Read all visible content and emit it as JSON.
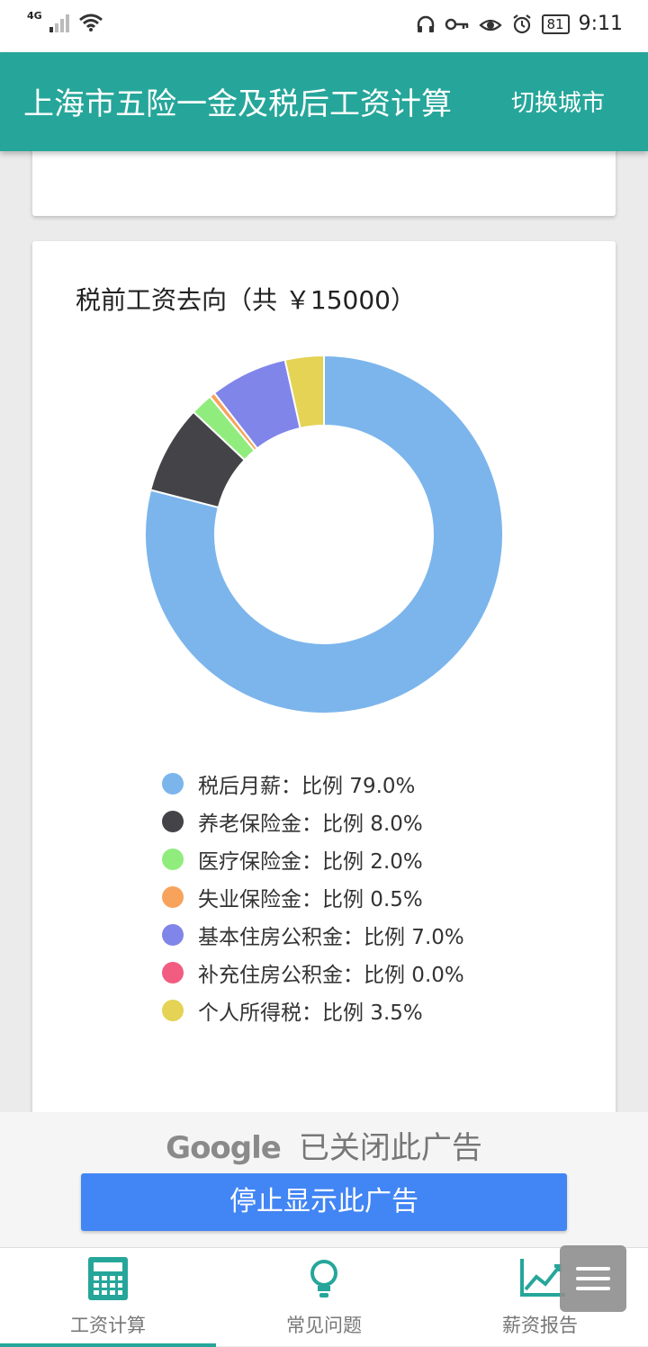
{
  "status_bar": {
    "network": "4G",
    "battery": "81",
    "time": "9:11"
  },
  "app_bar": {
    "title": "上海市五险一金及税后工资计算",
    "action": "切换城市"
  },
  "main_card": {
    "title": "税前工资去向（共 ￥15000）"
  },
  "chart_data": {
    "type": "pie",
    "title": "税前工资去向（共 ￥15000）",
    "total": 15000,
    "slices": [
      {
        "label": "税后月薪：比例 79.0%",
        "value": 79.0,
        "color": "#7cb5ec"
      },
      {
        "label": "养老保险金：比例 8.0%",
        "value": 8.0,
        "color": "#434348"
      },
      {
        "label": "医疗保险金：比例 2.0%",
        "value": 2.0,
        "color": "#90ed7d"
      },
      {
        "label": "失业保险金：比例 0.5%",
        "value": 0.5,
        "color": "#f7a35c"
      },
      {
        "label": "基本住房公积金：比例 7.0%",
        "value": 7.0,
        "color": "#8085e9"
      },
      {
        "label": "补充住房公积金：比例 0.0%",
        "value": 0.0,
        "color": "#f15c80"
      },
      {
        "label": "个人所得税：比例 3.5%",
        "value": 3.5,
        "color": "#e4d354"
      }
    ],
    "legend_position": "bottom"
  },
  "ad": {
    "brand": "Google",
    "closed_text": "已关闭此广告",
    "stop_button": "停止显示此广告"
  },
  "bottom_nav": {
    "items": [
      {
        "label": "工资计算",
        "icon": "calculator-icon"
      },
      {
        "label": "常见问题",
        "icon": "lightbulb-icon"
      },
      {
        "label": "薪资报告",
        "icon": "chart-icon"
      }
    ]
  },
  "colors": {
    "primary": "#26a69a",
    "ad_button": "#4285f4"
  }
}
